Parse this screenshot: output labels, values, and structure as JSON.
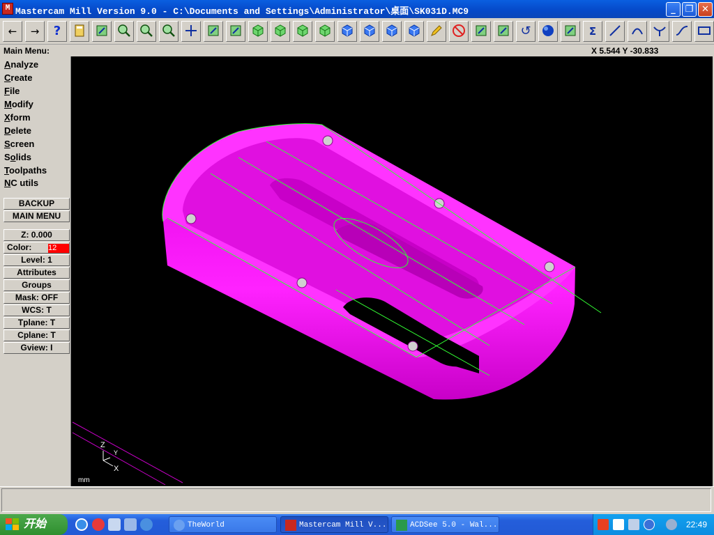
{
  "window": {
    "title": "Mastercam Mill Version 9.0 - C:\\Documents and Settings\\Administrator\\桌面\\SK031D.MC9",
    "app_icon_text": "M"
  },
  "toolbar": {
    "buttons": [
      {
        "name": "back-button",
        "icon": "arrow-left-icon",
        "glyph": "←"
      },
      {
        "name": "forward-button",
        "icon": "arrow-right-icon",
        "glyph": "→"
      },
      {
        "name": "help-button",
        "icon": "question-mark-icon",
        "glyph": "?"
      },
      {
        "name": "calculator-button",
        "icon": "calculator-icon",
        "glyph": ""
      },
      {
        "name": "analyze-button",
        "icon": "pointer-question-icon",
        "glyph": ""
      },
      {
        "name": "zoom-button",
        "icon": "zoom-icon",
        "glyph": ""
      },
      {
        "name": "unzoom-button",
        "icon": "unzoom-icon",
        "glyph": ""
      },
      {
        "name": "zoom-8-button",
        "icon": "zoom-8-icon",
        "glyph": ""
      },
      {
        "name": "pan-button",
        "icon": "pan-arrows-icon",
        "glyph": ""
      },
      {
        "name": "fit-button",
        "icon": "fit-window-icon",
        "glyph": ""
      },
      {
        "name": "rotate-button",
        "icon": "rotate-cube-icon",
        "glyph": ""
      },
      {
        "name": "view-top-button",
        "icon": "cube-top-icon",
        "glyph": ""
      },
      {
        "name": "view-front-button",
        "icon": "cube-front-icon",
        "glyph": ""
      },
      {
        "name": "view-side-button",
        "icon": "cube-side-icon",
        "glyph": ""
      },
      {
        "name": "view-iso-button",
        "icon": "cube-iso-icon",
        "glyph": ""
      },
      {
        "name": "cplane-top-button",
        "icon": "cube-blue-top-icon",
        "glyph": ""
      },
      {
        "name": "cplane-front-button",
        "icon": "cube-blue-front-icon",
        "glyph": ""
      },
      {
        "name": "cplane-side-button",
        "icon": "cube-blue-side-icon",
        "glyph": ""
      },
      {
        "name": "cplane-3d-button",
        "icon": "cube-blue-3d-icon",
        "glyph": ""
      },
      {
        "name": "pencil-button",
        "icon": "pencil-icon",
        "glyph": ""
      },
      {
        "name": "delete-button",
        "icon": "no-entry-icon",
        "glyph": ""
      },
      {
        "name": "xform-button-1",
        "icon": "xform-translate-icon",
        "glyph": ""
      },
      {
        "name": "xform-button-2",
        "icon": "xform-array-icon",
        "glyph": ""
      },
      {
        "name": "undo-button",
        "icon": "undo-arrow-icon",
        "glyph": "↺"
      },
      {
        "name": "shade-button",
        "icon": "blue-sphere-icon",
        "glyph": ""
      },
      {
        "name": "solid-button",
        "icon": "solids-icon",
        "glyph": ""
      },
      {
        "name": "sum-button",
        "icon": "sigma-icon",
        "glyph": "Σ"
      },
      {
        "name": "line-button",
        "icon": "line-icon",
        "glyph": ""
      },
      {
        "name": "arc-button",
        "icon": "arc-icon",
        "glyph": ""
      },
      {
        "name": "fillet-button",
        "icon": "fillet-icon",
        "glyph": ""
      },
      {
        "name": "spline-button",
        "icon": "spline-icon",
        "glyph": ""
      },
      {
        "name": "rectangle-button",
        "icon": "rectangle-icon",
        "glyph": ""
      }
    ]
  },
  "header": {
    "main_menu_label": "Main Menu:",
    "coordinates": "X 5.544  Y -30.833"
  },
  "menu": {
    "items": [
      {
        "key": "A",
        "rest": "nalyze"
      },
      {
        "key": "C",
        "rest": "reate"
      },
      {
        "key": "F",
        "rest": "ile"
      },
      {
        "key": "M",
        "rest": "odify"
      },
      {
        "key": "X",
        "rest": "form"
      },
      {
        "key": "D",
        "rest": "elete"
      },
      {
        "key": "S",
        "rest": "creen"
      },
      {
        "key": "So",
        "rest": "lids",
        "split": true
      },
      {
        "key": "T",
        "rest": "oolpaths"
      },
      {
        "key": "N",
        "rest": "C utils"
      }
    ],
    "solids_prefix": "S",
    "solids_key": "o",
    "solids_rest": "lids",
    "backup": "BACKUP",
    "main_menu": "MAIN MENU"
  },
  "secondary": {
    "z": "Z:  0.000",
    "color_label": "Color:",
    "color_value": "12",
    "color_swatch": "#ff0000",
    "level": "Level:  1",
    "attributes": "Attributes",
    "groups": "Groups",
    "mask": "Mask:  OFF",
    "wcs": "WCS:   T",
    "tplane": "Tplane:  T",
    "cplane": "Cplane:  T",
    "gview": "Gview:   I"
  },
  "viewport": {
    "axis_z": "Z",
    "axis_y": "Y",
    "axis_x": "X",
    "units": "mm",
    "part_color": "#ff00ff",
    "wire_color": "#33ff33"
  },
  "taskbar": {
    "start_label": "开始",
    "tasks": [
      {
        "label": "TheWorld",
        "active": false
      },
      {
        "label": "Mastercam Mill V...",
        "active": true
      },
      {
        "label": "ACDSee 5.0 - Wal...",
        "active": false
      }
    ],
    "clock": "22:49"
  }
}
